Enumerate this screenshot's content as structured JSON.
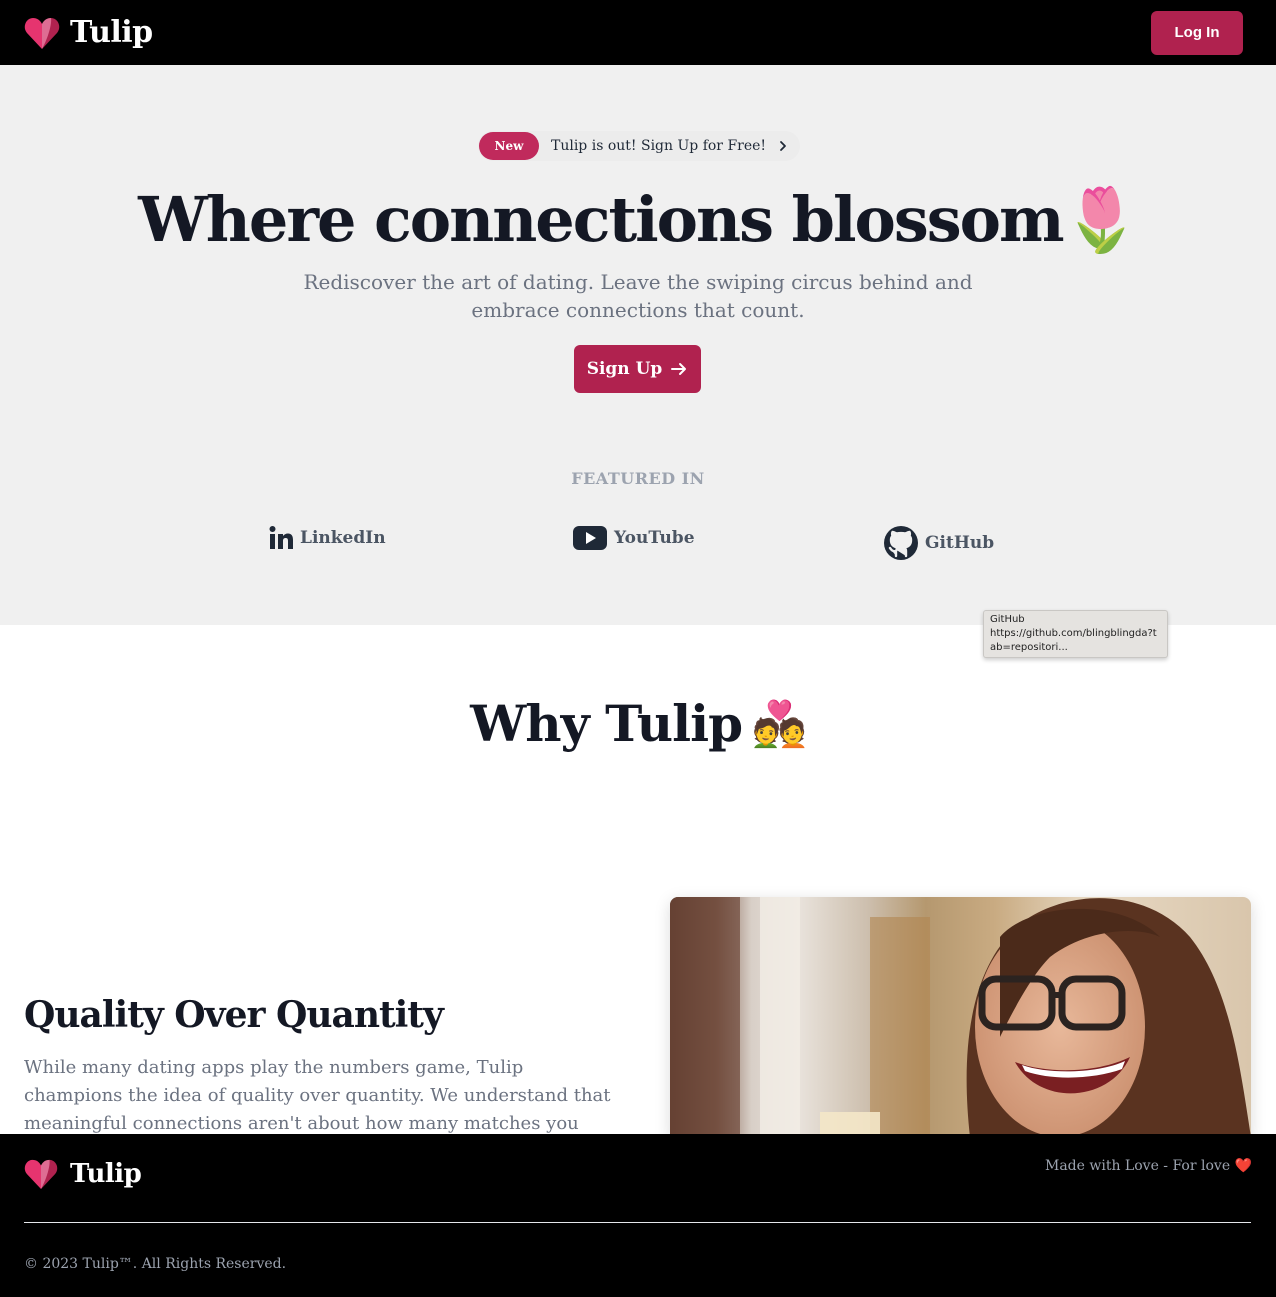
{
  "header": {
    "brand": "Tulip",
    "login_label": "Log In"
  },
  "hero": {
    "badge": "New",
    "announcement": "Tulip is out! Sign Up for Free!",
    "title": "Where connections blossom",
    "title_emoji": "🌷",
    "subtitle": "Rediscover the art of dating. Leave the swiping circus behind and embrace connections that count.",
    "signup_label": "Sign Up"
  },
  "featured": {
    "title": "FEATURED IN",
    "items": [
      {
        "label": "LinkedIn",
        "icon": "linkedin-icon"
      },
      {
        "label": "YouTube",
        "icon": "youtube-icon"
      },
      {
        "label": "GitHub",
        "icon": "github-icon"
      }
    ]
  },
  "tooltip": {
    "title": "GitHub",
    "url": "https://github.com/blingblingda?tab=repositori..."
  },
  "why": {
    "title": "Why Tulip",
    "emoji": "💑"
  },
  "feature": {
    "title": "Quality Over Quantity",
    "body": "While many dating apps play the numbers game, Tulip champions the idea of quality over quantity. We understand that meaningful connections aren't about how many matches you"
  },
  "footer": {
    "brand": "Tulip",
    "tagline": "Made with Love - For love ❤️",
    "copyright": "© 2023 Tulip™. All Rights Reserved."
  },
  "colors": {
    "accent": "#b0224f",
    "badge": "#c02a5c",
    "hero_bg": "#f0f0f0",
    "header_bg": "#000000"
  }
}
